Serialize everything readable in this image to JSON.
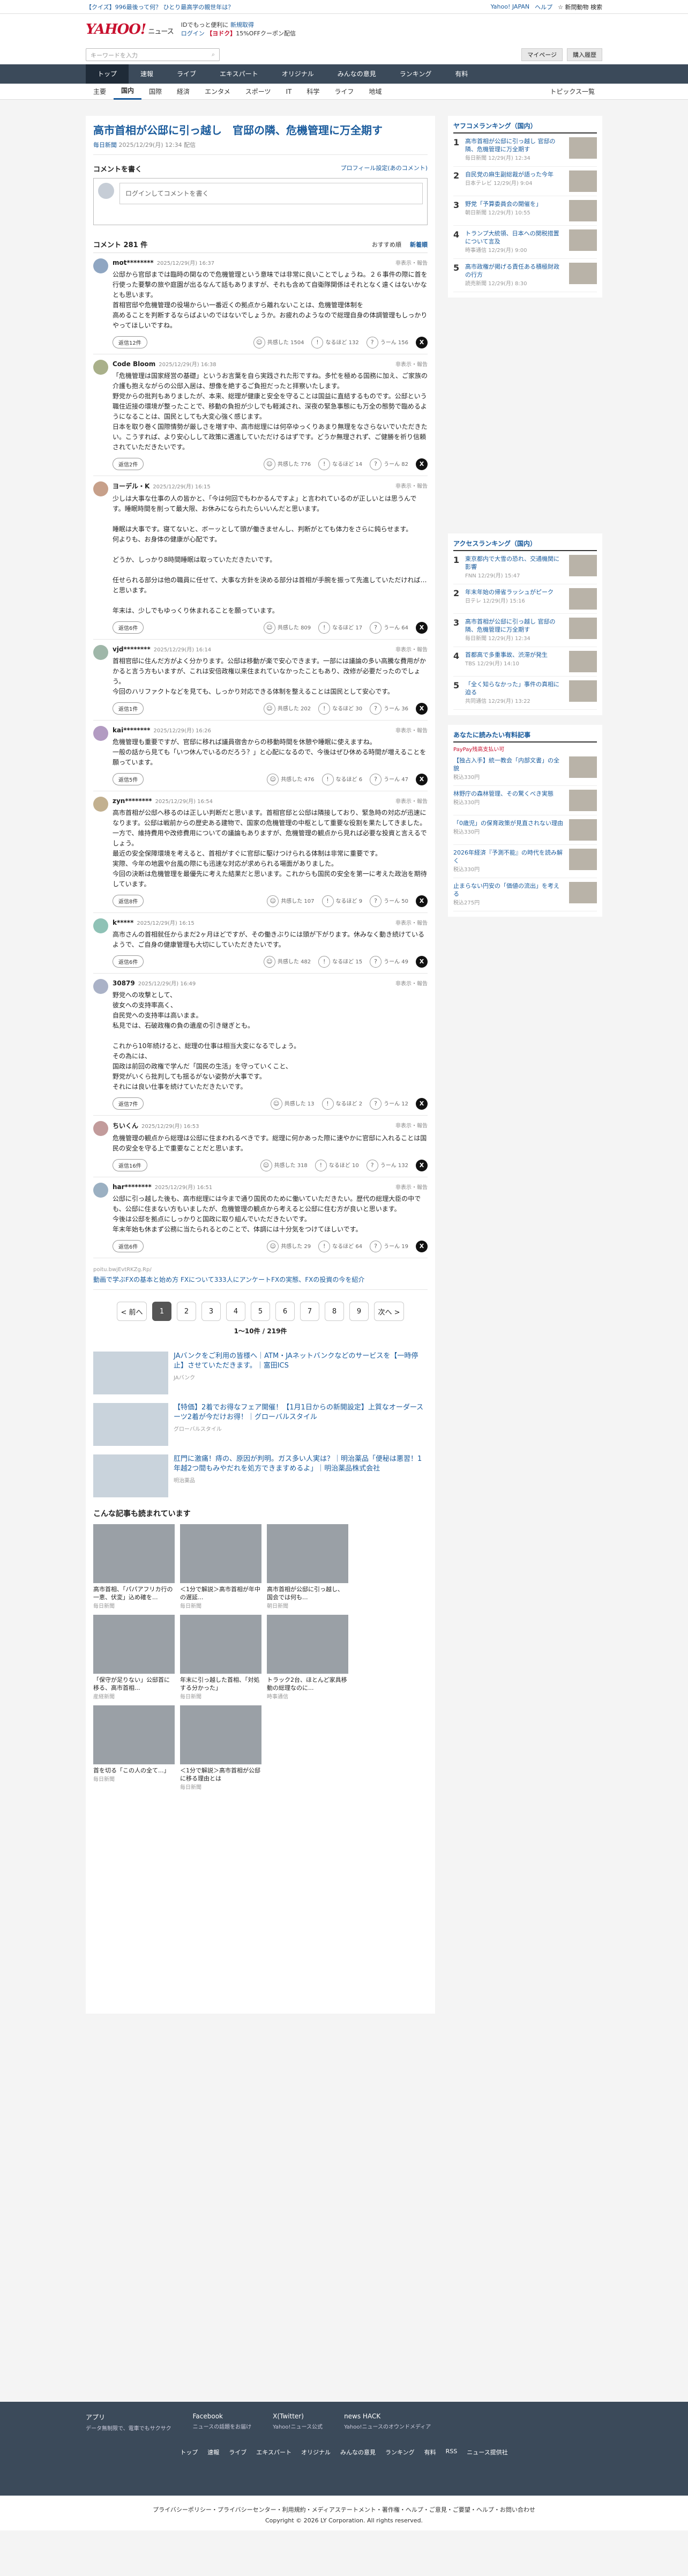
{
  "topbar": {
    "promo": "【クイズ】996最後って何？ ひとり最高学の親世年は？",
    "links": [
      "Yahoo! JAPAN",
      "ヘルプ"
    ],
    "calendar": "☆ 新問動物 検索"
  },
  "header": {
    "logo": "YAHOO!",
    "logo_sub": "JAPAN",
    "service": "ニュース",
    "msg1": "IDでもっと便利に",
    "msg1b": "新規取得",
    "msg2": "ログイン",
    "msg2b": "【ヨドク】",
    "msg2c": "15%OFFクーポン配信"
  },
  "search": {
    "placeholder": "キーワードを入力",
    "button": "検索",
    "account": "マイページ",
    "paid": "購入履歴"
  },
  "nav": {
    "items": [
      "トップ",
      "速報",
      "ライブ",
      "エキスパート",
      "オリジナル",
      "みんなの意見",
      "ランキング",
      "有料"
    ]
  },
  "subnav": {
    "items": [
      "主要",
      "国内",
      "国際",
      "経済",
      "エンタメ",
      "スポーツ",
      "IT",
      "科学",
      "ライフ",
      "地域"
    ],
    "right": "トピックス一覧"
  },
  "article": {
    "title": "高市首相が公邸に引っ越し　官邸の隣、危機管理に万全期す",
    "source": "毎日新聞",
    "time": "2025/12/29(月) 12:34 配信"
  },
  "write": {
    "label": "コメントを書く",
    "link": "プロフィール設定(あのコメント)",
    "input": "ログインしてコメントを書く"
  },
  "list": {
    "title": "コメント 281 件",
    "sort_a": "おすすめ順",
    "sort_b": "新着順"
  },
  "comments": [
    {
      "name": "mot********",
      "time": "2025/12/29(月) 16:37",
      "report": "非表示・報告",
      "text": "公邸から官邸までは臨時の関なので危機管理という意味では非常に良いことでしょうね。２６事件の際に首を行使った要撃の旅や庭園が出るなんて話もありますが、それも含めて自衛隊関係はそれとなく遠くはないかなとも思います。\n首相官邸や危機管理の役場からい一番近くの拠点から離れないことは、危機管理体制を\n高めることを判断するならばよいのではないでしょうか。お疲れのようなので総理自身の体調管理もしっかりやってほしいですね。",
      "reply": "返信12件",
      "c1": "共感した",
      "v1": "1504",
      "c2": "なるほど",
      "v2": "132",
      "c3": "うーん",
      "v3": "156"
    },
    {
      "name": "Code Bloom",
      "time": "2025/12/29(月) 16:38",
      "report": "非表示・報告",
      "text": "「危機管理は国家経営の基礎」というお言葉を自ら実践された形ですね。多忙を極める国務に加え、ご家族の介護も抱えながらの公邸入居は、想像を絶するご負担だったと拝察いたします。\n野党からの批判もありましたが、本来、総理が健康と安全を守ることは国益に直結するものです。公邸という職住近接の環境が整ったことで、移動の負担が少しでも軽減され、深夜の緊急事態にも万全の態勢で臨めるようになることは、国民としても大変心強く感じます。\n日本を取り巻く国際情勢が厳しさを増す中、高市総理には何卒ゆっくりあまり無理をなさらないでいただきたい。こうすれば、より安心しして政策に邁進していただけるはずです。どうか無理されず、ご健勝を祈り信頼されていただきたいです。",
      "reply": "返信2件",
      "c1": "共感した",
      "v1": "776",
      "c2": "なるほど",
      "v2": "14",
      "c3": "うーん",
      "v3": "82"
    },
    {
      "name": "ヨーデル・K",
      "time": "2025/12/29(月) 16:15",
      "report": "非表示・報告",
      "text": "少しは大事な仕事の人の皆かと、「今は何回でもわかるんですよ」と言われているのが正しいとは思うんです。睡眠時間を削って最大限、お休みになられたらいいんだと思います。\n\n睡眠は大事です。寝てないと、ボーッとして頭が働きませんし、判断がとても体力をさらに鈍らせます。\n何よりも、お身体の健康が心配です。\n\nどうか、しっかり8時間睡眠は取っていただきたいです。\n\n任せられる部分は他の職員に任せて、大事な方針を決める部分は首相が手腕を振って先進していただければ…と思います。\n\n年末は、少しでもゆっくり休まれることを願っています。",
      "reply": "返信6件",
      "c1": "共感した",
      "v1": "809",
      "c2": "なるほど",
      "v2": "17",
      "c3": "うーん",
      "v3": "64"
    },
    {
      "name": "vjd********",
      "time": "2025/12/29(月) 16:14",
      "report": "非表示・報告",
      "text": "首相官邸に住んだ方がよく分かります。公邸は移動が楽で安心できます。一部には議論の多い高騰な費用がかかると言う方もいますが、これは安倍政権以来住まれていなかったこともあり、改修が必要だったのでしょう。\n今回のハリファクトなどを見ても、しっかり対応できる体制を整えることは国民として安心です。",
      "reply": "返信1件",
      "c1": "共感した",
      "v1": "202",
      "c2": "なるほど",
      "v2": "30",
      "c3": "うーん",
      "v3": "36"
    },
    {
      "name": "kai********",
      "time": "2025/12/29(月) 16:26",
      "report": "非表示・報告",
      "text": "危機管理も重要ですが、官邸に移れば議員宿舎からの移動時間を休憩や睡眠に使えますね。\n一般の話から見ても「いつ休んでいるのだろう？」と心配になるので、今後はぜひ休める時間が増えることを願っています。",
      "reply": "返信5件",
      "c1": "共感した",
      "v1": "476",
      "c2": "なるほど",
      "v2": "6",
      "c3": "うーん",
      "v3": "47"
    },
    {
      "name": "zyn********",
      "time": "2025/12/29(月) 16:54",
      "report": "非表示・報告",
      "text": "高市首相が公邸へ移るのは正しい判断だと思います。首相官邸と公邸は隣接しており、緊急時の対応が迅速になります。公邸は戦前からの歴史ある建物で、国家の危機管理の中枢として重要な役割を果たしてきました。一方で、維持費用や改修費用についての議論もありますが、危機管理の観点から見れば必要な投資と言えるでしょう。\n最近の安全保障環境を考えると、首相がすぐに官邸に駆けつけられる体制は非常に重要です。\n実際、今年の地震や台風の際にも迅速な対応が求められる場面がありました。\n今回の決断は危機管理を最優先に考えた結果だと思います。これからも国民の安全を第一に考えた政治を期待しています。",
      "reply": "返信8件",
      "c1": "共感した",
      "v1": "107",
      "c2": "なるほど",
      "v2": "9",
      "c3": "うーん",
      "v3": "50"
    },
    {
      "name": "k*****",
      "time": "2025/12/29(月) 16:15",
      "report": "非表示・報告",
      "text": "高市さんの首相就任からまだ2ヶ月ほどですが、その働きぶりには頭が下がります。休みなく動き続けているようで、ご自身の健康管理も大切にしていただきたいです。",
      "reply": "返信6件",
      "c1": "共感した",
      "v1": "482",
      "c2": "なるほど",
      "v2": "15",
      "c3": "うーん",
      "v3": "49"
    },
    {
      "name": "30879",
      "time": "2025/12/29(月) 16:49",
      "report": "非表示・報告",
      "text": "野党への攻撃として、\n彼女への支持率高く、\n自民党への支持率は高いまま。\n私見では、石破政権の負の遺産の引き継ぎとも。\n\nこれから10年続けると、総理の仕事は相当大変になるでしょう。\nその為には、\n国政は前回の政権で学んだ「国民の生活」を守っていくこと、\n野党がいくら批判しても揺るがない姿勢が大事です。\nそれには良い仕事を続けていただきたいです。",
      "reply": "返信7件",
      "c1": "共感した",
      "v1": "13",
      "c2": "なるほど",
      "v2": "2",
      "c3": "うーん",
      "v3": "12"
    },
    {
      "name": "ちいくん",
      "time": "2025/12/29(月) 16:53",
      "report": "非表示・報告",
      "text": "危機管理の観点から総理は公邸に住まわれるべきです。総理に何かあった際に速やかに官邸に入れることは国民の安全を守る上で重要なことだと思います。",
      "reply": "返信16件",
      "c1": "共感した",
      "v1": "318",
      "c2": "なるほど",
      "v2": "10",
      "c3": "うーん",
      "v3": "132"
    },
    {
      "name": "har********",
      "time": "2025/12/29(月) 16:51",
      "report": "非表示・報告",
      "text": "公邸に引っ越した後も、高市総理には今まで通り国民のために働いていただきたい。歴代の総理大臣の中でも、公邸に住まない方もいましたが、危機管理の観点から考えると公邸に住む方が良いと思います。\n今後は公邸を拠点にしっかりと国政に取り組んでいただきたいです。\n年末年始も休まず公務に当たられるとのことで、体調には十分気をつけてほしいです。",
      "reply": "返信6件",
      "c1": "共感した",
      "v1": "29",
      "c2": "なるほど",
      "v2": "64",
      "c3": "うーん",
      "v3": "19"
    }
  ],
  "ad_inline": {
    "source": "poitu.bwjEvtRKZg.Rp/",
    "text": "動画で学ぶFXの基本と始め方 FXについて333人にアンケートFXの実態、FXの投資の今を紹介"
  },
  "pagination": {
    "prev": "< 前へ",
    "pages": [
      "1",
      "2",
      "3",
      "4",
      "5",
      "6",
      "7",
      "8",
      "9"
    ],
    "next": "次へ >",
    "info": "1～10件 / 219件"
  },
  "ads": [
    {
      "title": "JAバンクをご利用の皆様へ｜ATM・JAネットバンクなどのサービスを【一時停止】させていただきます。｜富田ICS",
      "src": "JAバンク"
    },
    {
      "title": "【特価】2着でお得なフェア開催！【1月1日からの新開設定】上質なオーダースーツ2着が今だけお得！｜グローバルスタイル",
      "src": "グローバルスタイル"
    },
    {
      "title": "肛門に激痛！痔の、原因が判明。ガス多い人実は？｜明治薬品「便秘は悪習！1年越2つ間もみやだれを処方できますめるよ」｜明治薬品株式会社",
      "src": "明治薬品"
    }
  ],
  "also": {
    "title": "こんな記事も読まれています",
    "items": [
      {
        "t": "高市首相、「パパアフリカ行の一恵、伏変」込め確を...",
        "s": "毎日新聞"
      },
      {
        "t": "＜1分で解説＞高市首相が年中の遅延...",
        "s": "毎日新聞"
      },
      {
        "t": "高市首相が公邸に引っ越し、国会では何も...",
        "s": "朝日新聞"
      },
      {
        "t": "「保守が足りない」公邸首に移る、高市首相...",
        "s": "産経新聞"
      },
      {
        "t": "年末に引っ越した首相、「対処する分かった」",
        "s": "毎日新聞"
      },
      {
        "t": "トラック2台、ほとんど家具移動の総理なのに...",
        "s": "時事通信"
      },
      {
        "t": "首を切る「この人の全て...」",
        "s": "毎日新聞"
      },
      {
        "t": "＜1分で解説＞高市首相が公邸に移る理由とは",
        "s": "毎日新聞"
      }
    ]
  },
  "ranking": {
    "title": "ヤフコメランキング（国内）",
    "items": [
      {
        "n": "1",
        "t": "高市首相が公邸に引っ越し 官邸の隣、危機管理に万全期す",
        "s": "毎日新聞 12/29(月) 12:34"
      },
      {
        "n": "2",
        "t": "自民党の麻生副総裁が語った今年",
        "s": "日本テレビ 12/29(月) 9:04"
      },
      {
        "n": "3",
        "t": "野党「予算委員会の開催を」",
        "s": "朝日新聞 12/29(月) 10:55"
      },
      {
        "n": "4",
        "t": "トランプ大統領、日本への関税措置について言及",
        "s": "時事通信 12/29(月) 9:00"
      },
      {
        "n": "5",
        "t": "高市政権が掲げる責任ある積極財政の行方",
        "s": "読売新聞 12/29(月) 8:30"
      }
    ]
  },
  "ranking2": {
    "title": "アクセスランキング（国内）",
    "items": [
      {
        "n": "1",
        "t": "東京都内で大雪の恐れ、交通機関に影響",
        "s": "FNN 12/29(月) 15:47"
      },
      {
        "n": "2",
        "t": "年末年始の帰省ラッシュがピーク",
        "s": "日テレ 12/29(月) 15:16"
      },
      {
        "n": "3",
        "t": "高市首相が公邸に引っ越し 官邸の隣、危機管理に万全期す",
        "s": "毎日新聞 12/29(月) 12:34"
      },
      {
        "n": "4",
        "t": "首都高で多重事故、渋滞が発生",
        "s": "TBS 12/29(月) 14:10"
      },
      {
        "n": "5",
        "t": "「全く知らなかった」事件の真相に迫る",
        "s": "共同通信 12/29(月) 13:22"
      }
    ]
  },
  "side_ad": {
    "title": "あなたに読みたい有料記事",
    "src": "PayPay残高支払い可",
    "items": [
      {
        "t": "【独占入手】統一教会「内部文書」の全貌",
        "price": "税込330円"
      },
      {
        "t": "林野庁の森林管理、その驚くべき実態",
        "price": "税込330円"
      },
      {
        "t": "「0歳児」の保育政策が見直されない理由",
        "price": "税込330円"
      },
      {
        "t": "2026年経済『予測不能』の時代を読み解く",
        "price": "税込330円"
      },
      {
        "t": "止まらない円安の「価値の流出」を考える",
        "price": "税込275円"
      }
    ]
  },
  "footer": {
    "cols": [
      {
        "t": "アプリ",
        "s": "データ無制限で、電車でもサクサク"
      },
      {
        "t": "Facebook",
        "s": "ニュースの話題をお届け"
      },
      {
        "t": "X(Twitter)",
        "s": "Yahoo!ニュース公式"
      },
      {
        "t": "news HACK",
        "s": "Yahoo!ニュースのオウンドメディア"
      }
    ],
    "links": [
      "トップ",
      "速報",
      "ライブ",
      "エキスパート",
      "オリジナル",
      "みんなの意見",
      "ランキング",
      "有料",
      "RSS",
      "ニュース提供社"
    ],
    "legal": "プライバシーポリシー・プライバシーセンター・利用規約・メディアステートメント・著作権・ヘルプ・ご意見・ご要望・ヘルプ・お問い合わせ",
    "copy": "Copyright © 2026 LY Corporation. All rights reserved."
  }
}
